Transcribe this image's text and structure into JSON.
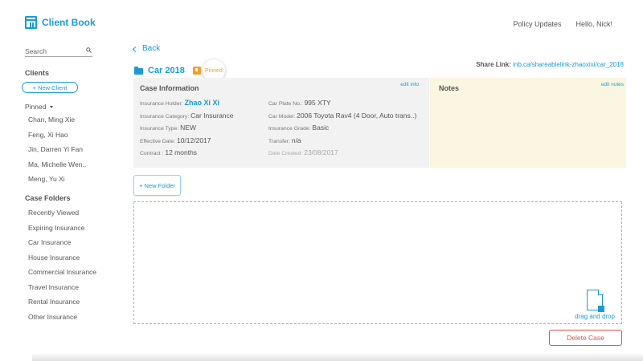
{
  "app": {
    "title": "Client Book"
  },
  "topnav": {
    "policy_updates": "Policy Updates",
    "greeting": "Hello, Nick!"
  },
  "search": {
    "placeholder": "Search",
    "value": ""
  },
  "sidebar": {
    "clients_heading": "Clients",
    "new_client_label": "+ New Client",
    "pinned_label": "Pinned",
    "pinned_clients": [
      "Chan, Ming Xie",
      "Feng, Xi Hao",
      "Jin, Darren Yi Fan",
      "Ma, Michelle Wen..",
      "Meng, Yu Xi"
    ],
    "folders_heading": "Case Folders",
    "folders": [
      "Recently Viewed",
      "Expiring Insurance",
      "Car Insurance",
      "House Insurance",
      "Commercial Insurance",
      "Travel Insurance",
      "Rental Insurance",
      "Other Insurance"
    ]
  },
  "main": {
    "back_label": "Back",
    "case_name": "Car 2018",
    "pinned_badge": "Pinned",
    "share_label": "Share Link:",
    "share_url": "inb.ca/shareablelink-zhaoxixi/car_2018",
    "info": {
      "title": "Case Information",
      "edit_label": "edit info",
      "insurance_holder_label": "Insurance Holder:",
      "insurance_holder": "Zhao Xi Xi",
      "insurance_category_label": "Insurance Category:",
      "insurance_category": "Car Insurance",
      "insurance_type_label": "Insurance Type:",
      "insurance_type": "NEW",
      "effective_date_label": "Effective Date:",
      "effective_date": "10/12/2017",
      "contract_label": "Contract :",
      "contract": "12 months",
      "car_plate_label": "Car Plate No.:",
      "car_plate": "995 XTY",
      "car_model_label": "Car Model:",
      "car_model": "2006 Toyota Rav4 (4 Door, Auto trans..)",
      "insurance_grade_label": "Insurance Grade:",
      "insurance_grade": "Basic",
      "transfer_label": "Transfer:",
      "transfer": "n/a",
      "date_created_label": "Date Created:",
      "date_created": "23/08/2017"
    },
    "notes": {
      "title": "Notes",
      "edit_label": "edit notes"
    },
    "new_folder_label": "+ New Folder",
    "drag_drop_label": "drag and drop",
    "delete_label": "Delete Case"
  },
  "colors": {
    "accent": "#1a9bd4",
    "pin": "#f0a030",
    "danger": "#d9534f",
    "notes_bg": "#fbf6e1",
    "info_bg": "#f2f2f2"
  }
}
